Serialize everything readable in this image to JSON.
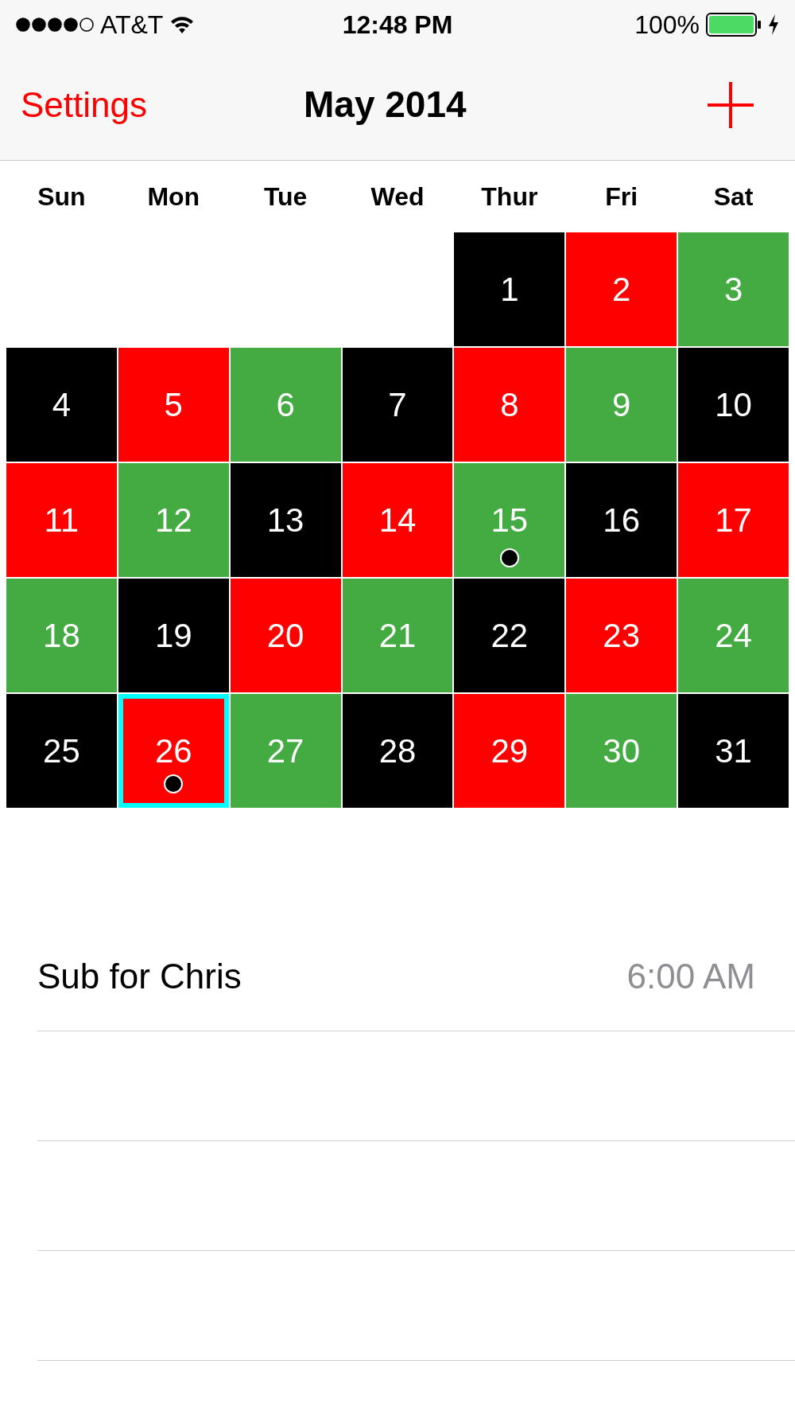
{
  "status_bar": {
    "carrier": "AT&T",
    "time": "12:48 PM",
    "battery": "100%"
  },
  "nav": {
    "left": "Settings",
    "title": "May 2014"
  },
  "weekdays": [
    "Sun",
    "Mon",
    "Tue",
    "Wed",
    "Thur",
    "Fri",
    "Sat"
  ],
  "weeks": [
    [
      {
        "kind": "blank"
      },
      {
        "kind": "blank"
      },
      {
        "kind": "blank"
      },
      {
        "kind": "blank"
      },
      {
        "kind": "day",
        "day": "1",
        "color": "#000000",
        "event": false,
        "selected": false
      },
      {
        "kind": "day",
        "day": "2",
        "color": "#ff0000",
        "event": false,
        "selected": false
      },
      {
        "kind": "day",
        "day": "3",
        "color": "#43ab42",
        "event": false,
        "selected": false
      }
    ],
    [
      {
        "kind": "day",
        "day": "4",
        "color": "#000000",
        "event": false,
        "selected": false
      },
      {
        "kind": "day",
        "day": "5",
        "color": "#ff0000",
        "event": false,
        "selected": false
      },
      {
        "kind": "day",
        "day": "6",
        "color": "#43ab42",
        "event": false,
        "selected": false
      },
      {
        "kind": "day",
        "day": "7",
        "color": "#000000",
        "event": false,
        "selected": false
      },
      {
        "kind": "day",
        "day": "8",
        "color": "#ff0000",
        "event": false,
        "selected": false
      },
      {
        "kind": "day",
        "day": "9",
        "color": "#43ab42",
        "event": false,
        "selected": false
      },
      {
        "kind": "day",
        "day": "10",
        "color": "#000000",
        "event": false,
        "selected": false
      }
    ],
    [
      {
        "kind": "day",
        "day": "11",
        "color": "#ff0000",
        "event": false,
        "selected": false
      },
      {
        "kind": "day",
        "day": "12",
        "color": "#43ab42",
        "event": false,
        "selected": false
      },
      {
        "kind": "day",
        "day": "13",
        "color": "#000000",
        "event": false,
        "selected": false
      },
      {
        "kind": "day",
        "day": "14",
        "color": "#ff0000",
        "event": false,
        "selected": false
      },
      {
        "kind": "day",
        "day": "15",
        "color": "#43ab42",
        "event": true,
        "selected": false
      },
      {
        "kind": "day",
        "day": "16",
        "color": "#000000",
        "event": false,
        "selected": false
      },
      {
        "kind": "day",
        "day": "17",
        "color": "#ff0000",
        "event": false,
        "selected": false
      }
    ],
    [
      {
        "kind": "day",
        "day": "18",
        "color": "#43ab42",
        "event": false,
        "selected": false
      },
      {
        "kind": "day",
        "day": "19",
        "color": "#000000",
        "event": false,
        "selected": false
      },
      {
        "kind": "day",
        "day": "20",
        "color": "#ff0000",
        "event": false,
        "selected": false
      },
      {
        "kind": "day",
        "day": "21",
        "color": "#43ab42",
        "event": false,
        "selected": false
      },
      {
        "kind": "day",
        "day": "22",
        "color": "#000000",
        "event": false,
        "selected": false
      },
      {
        "kind": "day",
        "day": "23",
        "color": "#ff0000",
        "event": false,
        "selected": false
      },
      {
        "kind": "day",
        "day": "24",
        "color": "#43ab42",
        "event": false,
        "selected": false
      }
    ],
    [
      {
        "kind": "day",
        "day": "25",
        "color": "#000000",
        "event": false,
        "selected": false
      },
      {
        "kind": "day",
        "day": "26",
        "color": "#ff0000",
        "event": true,
        "selected": true
      },
      {
        "kind": "day",
        "day": "27",
        "color": "#43ab42",
        "event": false,
        "selected": false
      },
      {
        "kind": "day",
        "day": "28",
        "color": "#000000",
        "event": false,
        "selected": false
      },
      {
        "kind": "day",
        "day": "29",
        "color": "#ff0000",
        "event": false,
        "selected": false
      },
      {
        "kind": "day",
        "day": "30",
        "color": "#43ab42",
        "event": false,
        "selected": false
      },
      {
        "kind": "day",
        "day": "31",
        "color": "#000000",
        "event": false,
        "selected": false
      }
    ]
  ],
  "events": [
    {
      "title": "Sub for Chris",
      "time": "6:00 AM"
    }
  ]
}
